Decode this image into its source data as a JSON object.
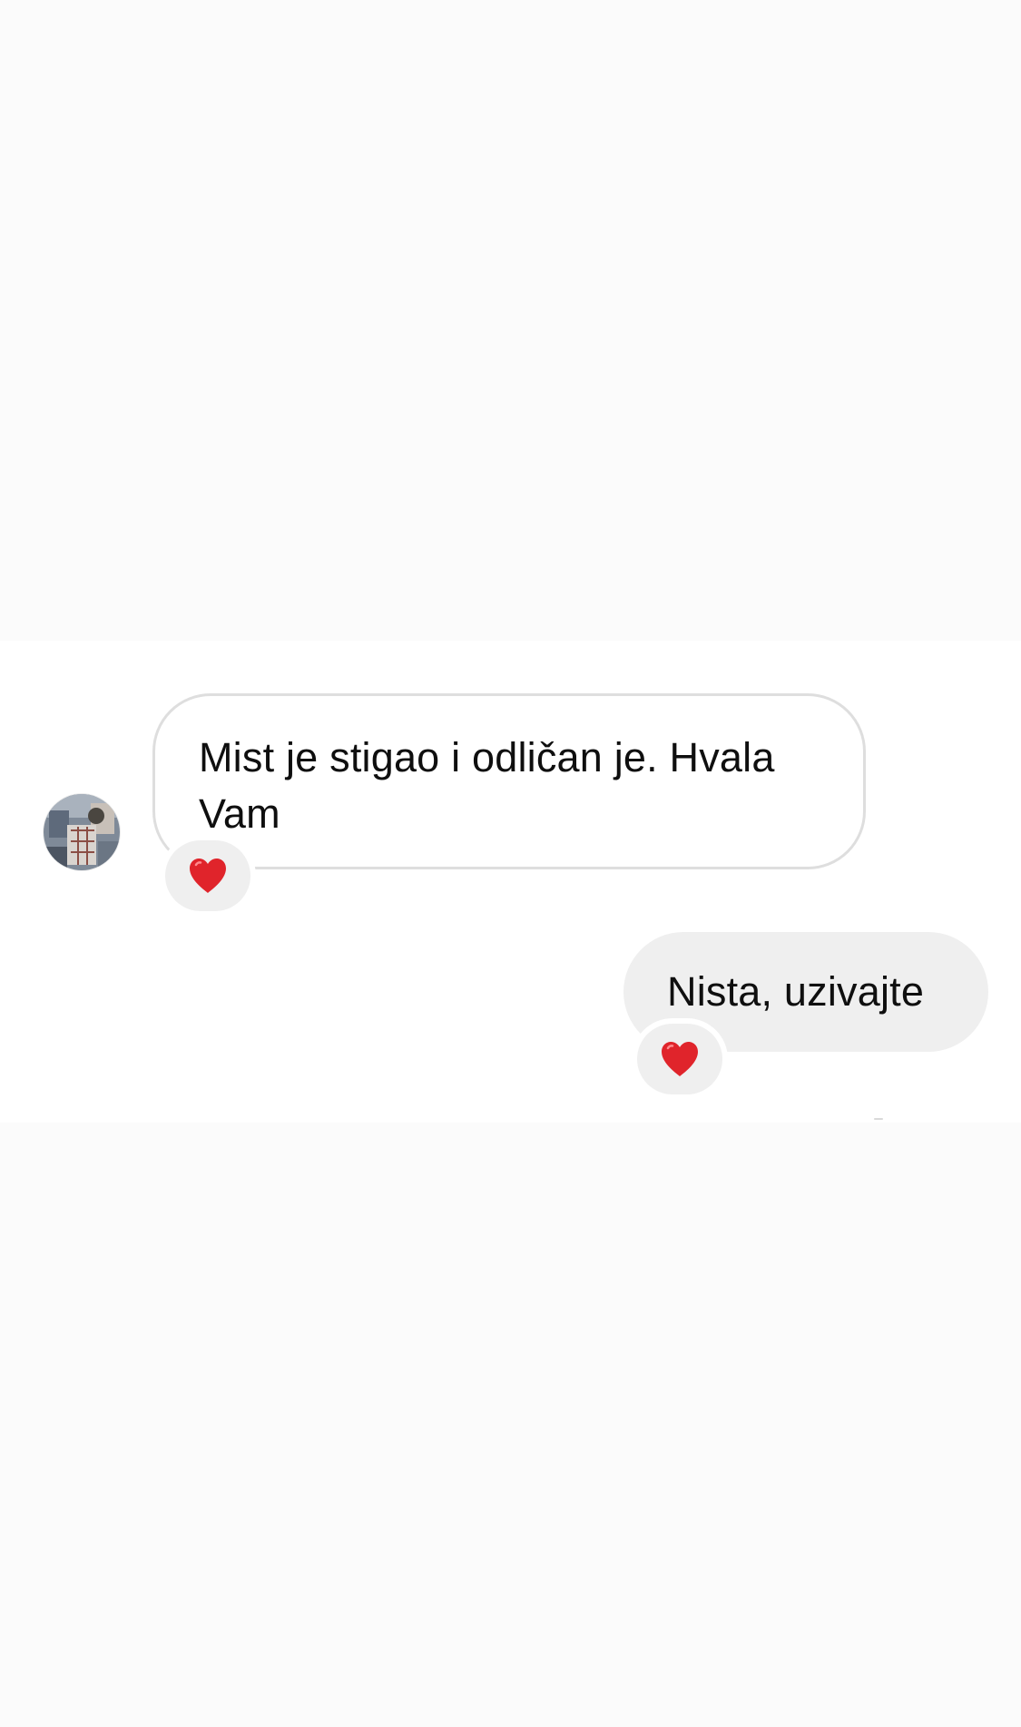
{
  "conversation": {
    "messages": [
      {
        "direction": "incoming",
        "text": "Mist je stigao i odličan je. Hvala Vam",
        "reaction": "heart",
        "reaction_color": "#e0242b"
      },
      {
        "direction": "outgoing",
        "text": "Nista, uzivajte",
        "reaction": "heart",
        "reaction_color": "#e0242b"
      }
    ]
  },
  "avatar": {
    "icon": "profile-photo",
    "colors": [
      "#5e6a7b",
      "#a9b2bd",
      "#c8c0b8",
      "#8b4e45"
    ]
  },
  "colors": {
    "background": "#fbfbfb",
    "chat_background": "#ffffff",
    "incoming_border": "#dedede",
    "outgoing_bubble": "#efefef",
    "text": "#0f0f0f"
  }
}
